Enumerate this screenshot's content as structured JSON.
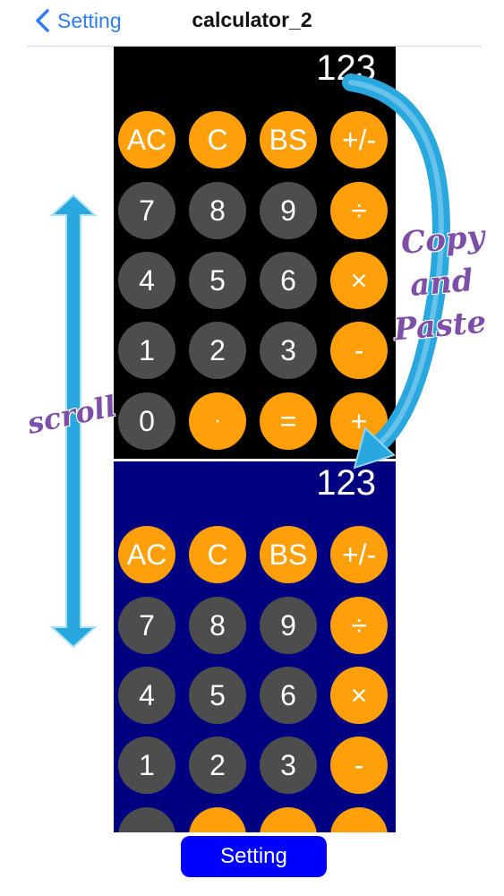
{
  "nav": {
    "back_label": "Setting",
    "title": "calculator_2"
  },
  "calculators": [
    {
      "display": "123",
      "background": "#000000",
      "keys": [
        "AC",
        "C",
        "BS",
        "+/-",
        "7",
        "8",
        "9",
        "÷",
        "4",
        "5",
        "6",
        "×",
        "1",
        "2",
        "3",
        "-",
        "0",
        "·",
        "=",
        "+"
      ]
    },
    {
      "display": "123",
      "background": "#000080",
      "keys": [
        "AC",
        "C",
        "BS",
        "+/-",
        "7",
        "8",
        "9",
        "÷",
        "4",
        "5",
        "6",
        "×",
        "1",
        "2",
        "3",
        "-",
        "",
        "",
        "",
        ""
      ]
    }
  ],
  "annotations": {
    "copy": "Copy",
    "and": "and",
    "paste": "Paste",
    "scroll": "scroll"
  },
  "bottom_button": {
    "label": "Setting"
  },
  "colors": {
    "operator": "#ff9f0a",
    "number": "#4d4d4d",
    "accent": "#2f7cf6",
    "bottom_button": "#0000ff",
    "arrow": "#29a8e0",
    "annotation_text": "#7e4fa8"
  },
  "icons": {
    "back": "chevron-left-icon",
    "copy_arrow": "curved-arrow-icon",
    "scroll_arrow": "double-arrow-icon"
  }
}
